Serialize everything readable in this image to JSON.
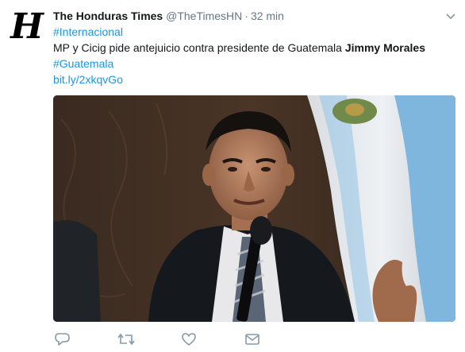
{
  "tweet": {
    "author_name": "The Honduras Times",
    "handle": "@TheTimesHN",
    "separator": "·",
    "time": "32 min",
    "avatar_letter": "H",
    "hashtag1": "#Internacional",
    "text_main": "MP y Cicig pide antejuicio contra presidente de Guatemala ",
    "text_bold": "Jimmy Morales",
    "hashtag2": "#Guatemala",
    "short_link": "bit.ly/2xkqvGo"
  },
  "colors": {
    "link": "#1b95e0",
    "muted": "#657786",
    "icon": "#8899a6"
  },
  "icons": [
    "reply-icon",
    "retweet-icon",
    "like-icon",
    "direct-message-icon",
    "caret-down-icon"
  ]
}
